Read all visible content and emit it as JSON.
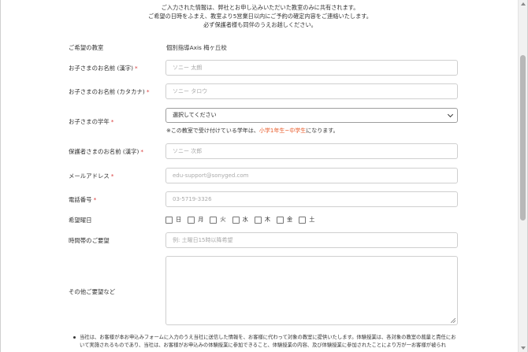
{
  "intro": [
    "ご入力された情報は、弊社とお申し込みいただいた教室のみに共有されます。",
    "ご希望の日時をふまえ、教室より5営業日以内にご予約の確定内容をご連絡いたします。",
    "必ず保護者様も同伴のうえお越しください。"
  ],
  "form": {
    "classroom": {
      "label": "ご希望の教室",
      "value": "個別指導Axis 梅ヶ丘校"
    },
    "child_name": {
      "label": "お子さまのお名前 (漢字)",
      "required": "*",
      "placeholder": "ソニー 太朗"
    },
    "child_kana": {
      "label": "お子さまのお名前 (カタカナ)",
      "required": "*",
      "placeholder": "ソニー タロウ"
    },
    "grade": {
      "label": "お子さまの学年",
      "required": "*",
      "selected": "選択してください",
      "note_prefix": "※この教室で受け付けている学年は、",
      "note_highlight": "小学1年生~中学生",
      "note_suffix": "になります。"
    },
    "guardian_name": {
      "label": "保護者さまのお名前 (漢字)",
      "required": "*",
      "placeholder": "ソニー 次郎"
    },
    "email": {
      "label": "メールアドレス",
      "required": "*",
      "placeholder": "edu-support@sonyged.com"
    },
    "phone": {
      "label": "電話番号",
      "required": "*",
      "placeholder": "03-5719-3326"
    },
    "days": {
      "label": "希望曜日",
      "options": [
        "日",
        "月",
        "火",
        "水",
        "木",
        "金",
        "土"
      ]
    },
    "time": {
      "label": "時間帯のご要望",
      "placeholder": "例: 土曜日15時以降希望"
    },
    "other": {
      "label": "その他ご要望など"
    }
  },
  "bottom_note": "当社は、お客様が本お申込みフォームに入力のうえ当社に送信した情報を、お客様に代わって対象の教室に提供いたします。体験授業は、各対象の教室の裁量と責任において実施されるものであり、当社は、お客様がお申込みの体験授業に参加できること、体験授業の内容、及び体験授業に参加されたことにより万が一お客様が被られ"
}
